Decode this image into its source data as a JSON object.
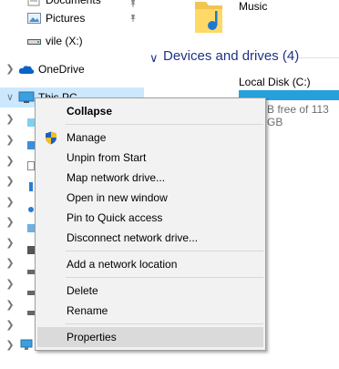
{
  "nav": {
    "documents_label": "Documents",
    "pictures_label": "Pictures",
    "vile_drive_label": "vile (X:)",
    "onedrive_label": "OneDrive",
    "thispc_label": "This PC"
  },
  "content": {
    "music_label": "Music",
    "devices_header": "Devices and drives (4)",
    "local_disk_label": "Local Disk (C:)",
    "local_disk_free": "B free of 113 GB"
  },
  "context_menu": {
    "items": [
      {
        "label": "Collapse"
      },
      {
        "label": "Manage"
      },
      {
        "label": "Unpin from Start"
      },
      {
        "label": "Map network drive..."
      },
      {
        "label": "Open in new window"
      },
      {
        "label": "Pin to Quick access"
      },
      {
        "label": "Disconnect network drive..."
      },
      {
        "label": "Add a network location"
      },
      {
        "label": "Delete"
      },
      {
        "label": "Rename"
      },
      {
        "label": "Properties"
      }
    ]
  },
  "colors": {
    "accent": "#26a0da",
    "selection": "#cce8ff",
    "header_text": "#1e3287"
  }
}
